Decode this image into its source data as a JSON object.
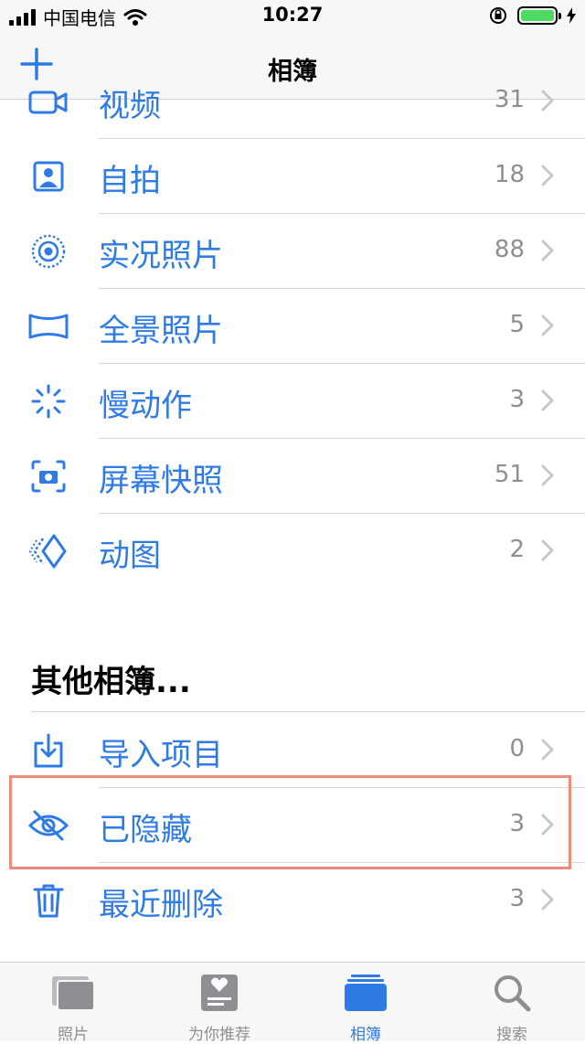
{
  "status": {
    "carrier": "中国电信",
    "time": "10:27"
  },
  "nav": {
    "title": "相簿"
  },
  "media_types": [
    {
      "label": "视频",
      "count": "31",
      "icon": "video-icon"
    },
    {
      "label": "自拍",
      "count": "18",
      "icon": "selfie-icon"
    },
    {
      "label": "实况照片",
      "count": "88",
      "icon": "live-photo-icon"
    },
    {
      "label": "全景照片",
      "count": "5",
      "icon": "panorama-icon"
    },
    {
      "label": "慢动作",
      "count": "3",
      "icon": "slow-motion-icon"
    },
    {
      "label": "屏幕快照",
      "count": "51",
      "icon": "screenshot-icon"
    },
    {
      "label": "动图",
      "count": "2",
      "icon": "animated-icon"
    }
  ],
  "other_albums": {
    "title": "其他相簿...",
    "items": [
      {
        "label": "导入项目",
        "count": "0",
        "icon": "import-icon"
      },
      {
        "label": "已隐藏",
        "count": "3",
        "icon": "hidden-eye-icon"
      },
      {
        "label": "最近删除",
        "count": "3",
        "icon": "trash-icon"
      }
    ]
  },
  "tabs": [
    {
      "label": "照片",
      "icon": "photos-tab-icon"
    },
    {
      "label": "为你推荐",
      "icon": "for-you-tab-icon"
    },
    {
      "label": "相簿",
      "icon": "albums-tab-icon"
    },
    {
      "label": "搜索",
      "icon": "search-tab-icon"
    }
  ],
  "colors": {
    "accent": "#2f7be5",
    "highlight_border": "#f08b7a",
    "battery": "#4cd964"
  }
}
